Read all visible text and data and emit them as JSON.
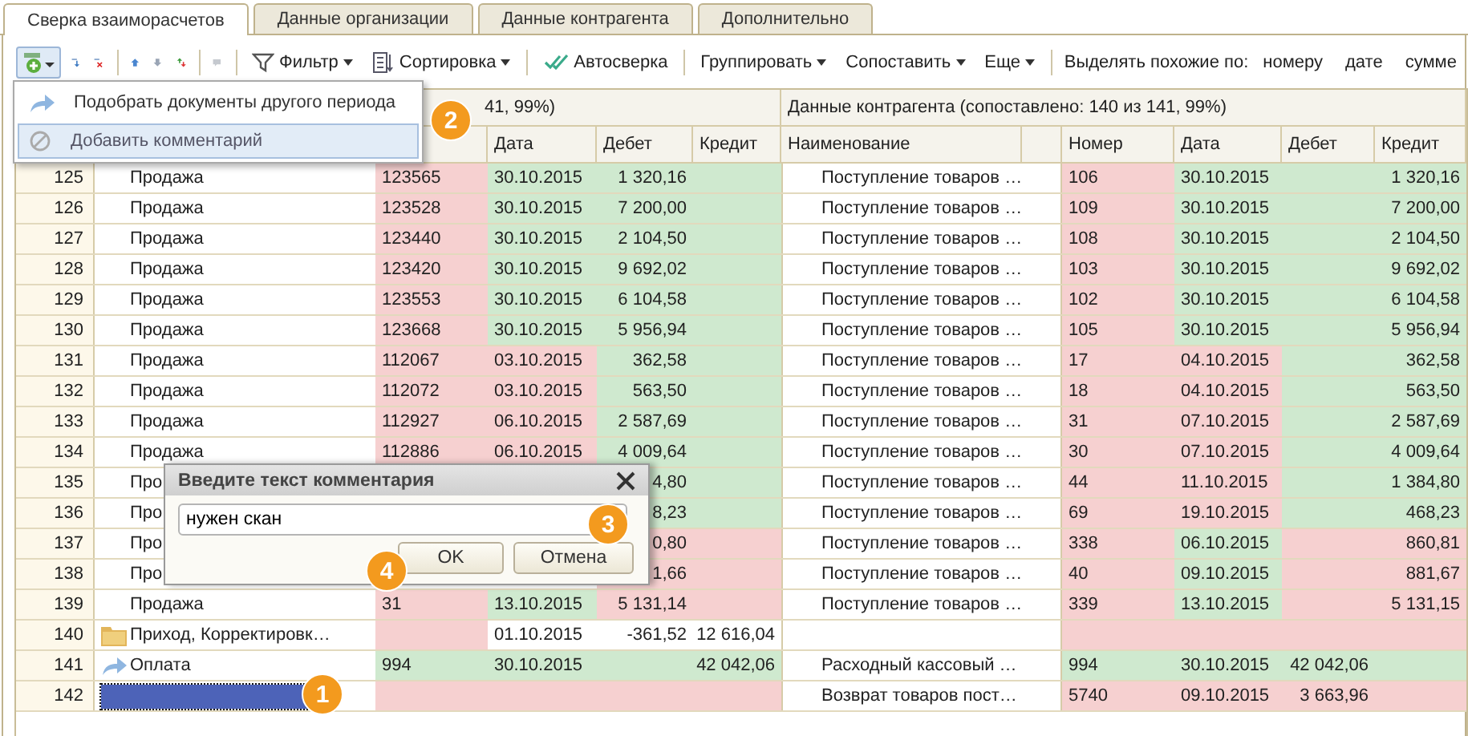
{
  "tabs": [
    {
      "label": "Сверка взаиморасчетов",
      "selected": true
    },
    {
      "label": "Данные организации",
      "selected": false
    },
    {
      "label": "Данные контрагента",
      "selected": false
    },
    {
      "label": "Дополнительно",
      "selected": false
    }
  ],
  "toolbar": {
    "text_buttons": [
      {
        "label": "Фильтр",
        "dropdown": true,
        "kind": "filter"
      },
      {
        "label": "Сортировка",
        "dropdown": true,
        "kind": "sort"
      },
      {
        "label": "Автосверка",
        "dropdown": false,
        "kind": "auto"
      },
      {
        "label": "Группировать",
        "dropdown": true,
        "kind": "plain"
      },
      {
        "label": "Сопоставить",
        "dropdown": true,
        "kind": "plain"
      },
      {
        "label": "Еще",
        "dropdown": true,
        "kind": "plain"
      }
    ],
    "similar_label": "Выделять похожие по:",
    "similar_options": [
      "номеру",
      "дате",
      "сумме"
    ]
  },
  "menu": [
    {
      "label": "Подобрать документы другого периода",
      "highlighted": false,
      "kind": "pick"
    },
    {
      "label": "Добавить комментарий",
      "highlighted": true,
      "kind": "comment"
    }
  ],
  "left_group": "41, 99%)",
  "right_group": "Данные контрагента (сопоставлено: 140 из 141, 99%)",
  "left_columns": [
    "Дата",
    "Дебет",
    "Кредит"
  ],
  "right_columns": [
    "Наименование",
    "Номер",
    "Дата",
    "Дебет",
    "Кредит"
  ],
  "rows": [
    {
      "number": "125",
      "name": "Продажа",
      "kind": "document",
      "selected": false,
      "left": [
        {
          "text": "123565",
          "color": "#f6d0d0"
        },
        {
          "text": "30.10.2015",
          "color": "#cfe9cf"
        },
        {
          "text": "1 320,16",
          "color": "#cfe9cf"
        },
        {
          "color": "#cfe9cf"
        }
      ],
      "right_name": "Поступление товаров …",
      "right": [
        {
          "text": "106",
          "color": "#f6d0d0"
        },
        {
          "text": "30.10.2015",
          "color": "#cfe9cf"
        },
        {
          "color": "#cfe9cf"
        },
        {
          "text": "1 320,16",
          "color": "#cfe9cf"
        }
      ]
    },
    {
      "number": "126",
      "name": "Продажа",
      "kind": "document",
      "selected": false,
      "left": [
        {
          "text": "123528",
          "color": "#f6d0d0"
        },
        {
          "text": "30.10.2015",
          "color": "#cfe9cf"
        },
        {
          "text": "7 200,00",
          "color": "#cfe9cf"
        },
        {
          "color": "#cfe9cf"
        }
      ],
      "right_name": "Поступление товаров …",
      "right": [
        {
          "text": "109",
          "color": "#f6d0d0"
        },
        {
          "text": "30.10.2015",
          "color": "#cfe9cf"
        },
        {
          "color": "#cfe9cf"
        },
        {
          "text": "7 200,00",
          "color": "#cfe9cf"
        }
      ]
    },
    {
      "number": "127",
      "name": "Продажа",
      "kind": "document",
      "selected": false,
      "left": [
        {
          "text": "123440",
          "color": "#f6d0d0"
        },
        {
          "text": "30.10.2015",
          "color": "#cfe9cf"
        },
        {
          "text": "2 104,50",
          "color": "#cfe9cf"
        },
        {
          "color": "#cfe9cf"
        }
      ],
      "right_name": "Поступление товаров …",
      "right": [
        {
          "text": "108",
          "color": "#f6d0d0"
        },
        {
          "text": "30.10.2015",
          "color": "#cfe9cf"
        },
        {
          "color": "#cfe9cf"
        },
        {
          "text": "2 104,50",
          "color": "#cfe9cf"
        }
      ]
    },
    {
      "number": "128",
      "name": "Продажа",
      "kind": "document",
      "selected": false,
      "left": [
        {
          "text": "123420",
          "color": "#f6d0d0"
        },
        {
          "text": "30.10.2015",
          "color": "#cfe9cf"
        },
        {
          "text": "9 692,02",
          "color": "#cfe9cf"
        },
        {
          "color": "#cfe9cf"
        }
      ],
      "right_name": "Поступление товаров …",
      "right": [
        {
          "text": "103",
          "color": "#f6d0d0"
        },
        {
          "text": "30.10.2015",
          "color": "#cfe9cf"
        },
        {
          "color": "#cfe9cf"
        },
        {
          "text": "9 692,02",
          "color": "#cfe9cf"
        }
      ]
    },
    {
      "number": "129",
      "name": "Продажа",
      "kind": "document",
      "selected": false,
      "left": [
        {
          "text": "123553",
          "color": "#f6d0d0"
        },
        {
          "text": "30.10.2015",
          "color": "#cfe9cf"
        },
        {
          "text": "6 104,58",
          "color": "#cfe9cf"
        },
        {
          "color": "#cfe9cf"
        }
      ],
      "right_name": "Поступление товаров …",
      "right": [
        {
          "text": "102",
          "color": "#f6d0d0"
        },
        {
          "text": "30.10.2015",
          "color": "#cfe9cf"
        },
        {
          "color": "#cfe9cf"
        },
        {
          "text": "6 104,58",
          "color": "#cfe9cf"
        }
      ]
    },
    {
      "number": "130",
      "name": "Продажа",
      "kind": "document",
      "selected": false,
      "left": [
        {
          "text": "123668",
          "color": "#f6d0d0"
        },
        {
          "text": "30.10.2015",
          "color": "#cfe9cf"
        },
        {
          "text": "5 956,94",
          "color": "#cfe9cf"
        },
        {
          "color": "#cfe9cf"
        }
      ],
      "right_name": "Поступление товаров …",
      "right": [
        {
          "text": "105",
          "color": "#f6d0d0"
        },
        {
          "text": "30.10.2015",
          "color": "#cfe9cf"
        },
        {
          "color": "#cfe9cf"
        },
        {
          "text": "5 956,94",
          "color": "#cfe9cf"
        }
      ]
    },
    {
      "number": "131",
      "name": "Продажа",
      "kind": "document",
      "selected": false,
      "left": [
        {
          "text": "112067",
          "color": "#f6d0d0"
        },
        {
          "text": "03.10.2015",
          "color": "#f6d0d0"
        },
        {
          "text": "362,58",
          "color": "#cfe9cf"
        },
        {
          "color": "#cfe9cf"
        }
      ],
      "right_name": "Поступление товаров …",
      "right": [
        {
          "text": "17",
          "color": "#f6d0d0"
        },
        {
          "text": "04.10.2015",
          "color": "#f6d0d0"
        },
        {
          "color": "#cfe9cf"
        },
        {
          "text": "362,58",
          "color": "#cfe9cf"
        }
      ]
    },
    {
      "number": "132",
      "name": "Продажа",
      "kind": "document",
      "selected": false,
      "left": [
        {
          "text": "112072",
          "color": "#f6d0d0"
        },
        {
          "text": "03.10.2015",
          "color": "#f6d0d0"
        },
        {
          "text": "563,50",
          "color": "#cfe9cf"
        },
        {
          "color": "#cfe9cf"
        }
      ],
      "right_name": "Поступление товаров …",
      "right": [
        {
          "text": "18",
          "color": "#f6d0d0"
        },
        {
          "text": "04.10.2015",
          "color": "#f6d0d0"
        },
        {
          "color": "#cfe9cf"
        },
        {
          "text": "563,50",
          "color": "#cfe9cf"
        }
      ]
    },
    {
      "number": "133",
      "name": "Продажа",
      "kind": "document",
      "selected": false,
      "left": [
        {
          "text": "112927",
          "color": "#f6d0d0"
        },
        {
          "text": "06.10.2015",
          "color": "#f6d0d0"
        },
        {
          "text": "2 587,69",
          "color": "#cfe9cf"
        },
        {
          "color": "#cfe9cf"
        }
      ],
      "right_name": "Поступление товаров …",
      "right": [
        {
          "text": "31",
          "color": "#f6d0d0"
        },
        {
          "text": "07.10.2015",
          "color": "#f6d0d0"
        },
        {
          "color": "#cfe9cf"
        },
        {
          "text": "2 587,69",
          "color": "#cfe9cf"
        }
      ]
    },
    {
      "number": "134",
      "name": "Продажа",
      "kind": "document",
      "selected": false,
      "left": [
        {
          "text": "112886",
          "color": "#f6d0d0"
        },
        {
          "text": "06.10.2015",
          "color": "#f6d0d0"
        },
        {
          "text": "4 009,64",
          "color": "#cfe9cf"
        },
        {
          "color": "#cfe9cf"
        }
      ],
      "right_name": "Поступление товаров …",
      "right": [
        {
          "text": "30",
          "color": "#f6d0d0"
        },
        {
          "text": "07.10.2015",
          "color": "#f6d0d0"
        },
        {
          "color": "#cfe9cf"
        },
        {
          "text": "4 009,64",
          "color": "#cfe9cf"
        }
      ]
    },
    {
      "number": "135",
      "name": "Про",
      "kind": "document",
      "selected": false,
      "left": [
        {
          "text": "4,80",
          "color": "#cfe9cf"
        },
        {
          "color": "#cfe9cf"
        }
      ],
      "right_name": "Поступление товаров …",
      "right": [
        {
          "text": "44",
          "color": "#f6d0d0"
        },
        {
          "text": "11.10.2015",
          "color": "#f6d0d0"
        },
        {
          "color": "#cfe9cf"
        },
        {
          "text": "1 384,80",
          "color": "#cfe9cf"
        }
      ]
    },
    {
      "number": "136",
      "name": "Про",
      "kind": "document",
      "selected": false,
      "left": [
        {
          "text": "8,23",
          "color": "#cfe9cf"
        },
        {
          "color": "#cfe9cf"
        }
      ],
      "right_name": "Поступление товаров …",
      "right": [
        {
          "text": "69",
          "color": "#f6d0d0"
        },
        {
          "text": "19.10.2015",
          "color": "#f6d0d0"
        },
        {
          "color": "#cfe9cf"
        },
        {
          "text": "468,23",
          "color": "#cfe9cf"
        }
      ]
    },
    {
      "number": "137",
      "name": "Про",
      "kind": "document",
      "selected": false,
      "left": [
        {
          "text": "0,80",
          "color": "#f6d0d0"
        },
        {
          "color": "#f6d0d0"
        }
      ],
      "right_name": "Поступление товаров …",
      "right": [
        {
          "text": "338",
          "color": "#f6d0d0"
        },
        {
          "text": "06.10.2015",
          "color": "#cfe9cf"
        },
        {
          "color": "#f6d0d0"
        },
        {
          "text": "860,81",
          "color": "#f6d0d0"
        }
      ]
    },
    {
      "number": "138",
      "name": "Про",
      "kind": "document",
      "selected": false,
      "left": [
        {
          "text": "1,66",
          "color": "#f6d0d0"
        },
        {
          "color": "#f6d0d0"
        }
      ],
      "right_name": "Поступление товаров …",
      "right": [
        {
          "text": "40",
          "color": "#f6d0d0"
        },
        {
          "text": "09.10.2015",
          "color": "#cfe9cf"
        },
        {
          "color": "#f6d0d0"
        },
        {
          "text": "881,67",
          "color": "#f6d0d0"
        }
      ]
    },
    {
      "number": "139",
      "name": "Продажа",
      "kind": "document",
      "selected": false,
      "left": [
        {
          "text": "31",
          "color": "#f6d0d0"
        },
        {
          "text": "13.10.2015",
          "color": "#cfe9cf"
        },
        {
          "text": "5 131,14",
          "color": "#f6d0d0"
        },
        {
          "color": "#f6d0d0"
        }
      ],
      "right_name": "Поступление товаров …",
      "right": [
        {
          "text": "339",
          "color": "#f6d0d0"
        },
        {
          "text": "13.10.2015",
          "color": "#cfe9cf"
        },
        {
          "color": "#f6d0d0"
        },
        {
          "text": "5 131,15",
          "color": "#f6d0d0"
        }
      ]
    },
    {
      "number": "140",
      "name": "Приход, Корректировк…",
      "kind": "folder",
      "selected": false,
      "left": [
        {
          "color": "#f6d0d0"
        },
        {
          "text": "01.10.2015",
          "color": "#ffffff"
        },
        {
          "text": "-361,52",
          "color": "#ffffff"
        },
        {
          "text": "12 616,04",
          "color": "#ffffff"
        }
      ],
      "right": [
        {
          "color": "#f6d0d0"
        },
        {
          "color": "#f6d0d0"
        },
        {
          "color": "#f6d0d0"
        },
        {
          "color": "#f6d0d0"
        }
      ]
    },
    {
      "number": "141",
      "name": "Оплата",
      "kind": "payment",
      "selected": false,
      "left": [
        {
          "text": "994",
          "color": "#cfe9cf"
        },
        {
          "text": "30.10.2015",
          "color": "#cfe9cf"
        },
        {
          "color": "#cfe9cf"
        },
        {
          "text": "42 042,06",
          "color": "#cfe9cf"
        }
      ],
      "right_name": "Расходный кассовый …",
      "right": [
        {
          "text": "994",
          "color": "#cfe9cf"
        },
        {
          "text": "30.10.2015",
          "color": "#cfe9cf"
        },
        {
          "text": "42 042,06",
          "color": "#cfe9cf"
        },
        {
          "color": "#cfe9cf"
        }
      ]
    },
    {
      "number": "142",
      "selected": true,
      "left": [
        {
          "color": "#f6d0d0"
        },
        {
          "color": "#f6d0d0"
        },
        {
          "color": "#f6d0d0"
        },
        {
          "color": "#f6d0d0"
        }
      ],
      "right_name": "Возврат товаров пост…",
      "right": [
        {
          "text": "5740",
          "color": "#f6d0d0"
        },
        {
          "text": "09.10.2015",
          "color": "#f6d0d0"
        },
        {
          "text": "3 663,96",
          "color": "#f6d0d0"
        },
        {
          "color": "#f6d0d0"
        }
      ]
    }
  ],
  "dialog": {
    "title": "Введите текст комментария",
    "value": "нужен скан",
    "buttons": [
      "OK",
      "Отмена"
    ]
  },
  "callouts": [
    "1",
    "2",
    "3",
    "4"
  ]
}
